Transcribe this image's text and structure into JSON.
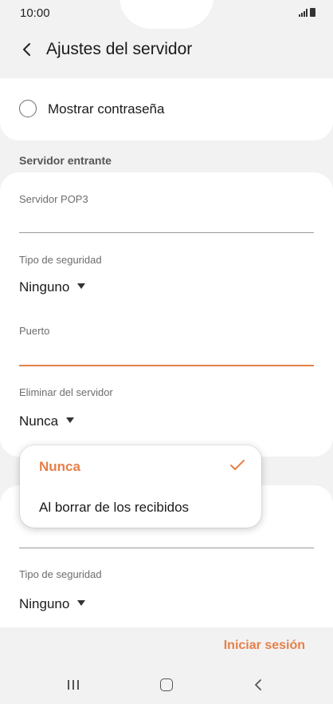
{
  "status_bar": {
    "time": "10:00"
  },
  "header": {
    "title": "Ajustes del servidor"
  },
  "show_password": {
    "label": "Mostrar contraseña",
    "checked": false
  },
  "incoming": {
    "section_title": "Servidor entrante",
    "pop3_label": "Servidor POP3",
    "pop3_value": "",
    "security_label": "Tipo de seguridad",
    "security_value": "Ninguno",
    "port_label": "Puerto",
    "port_value": "",
    "delete_label": "Eliminar del servidor",
    "delete_value": "Nunca"
  },
  "popup": {
    "options": [
      "Nunca",
      "Al borrar de los recibidos"
    ],
    "selected": "Nunca"
  },
  "outgoing": {
    "security_label": "Tipo de seguridad",
    "security_value": "Ninguno"
  },
  "actions": {
    "login_label": "Iniciar sesión"
  },
  "colors": {
    "accent": "#e5804a",
    "background": "#f2f2f2",
    "card": "#ffffff"
  },
  "icons": [
    "back-arrow-icon",
    "signal-icon",
    "battery-icon",
    "check-icon",
    "caret-down-icon",
    "nav-recent-icon",
    "nav-home-icon",
    "nav-back-icon"
  ]
}
